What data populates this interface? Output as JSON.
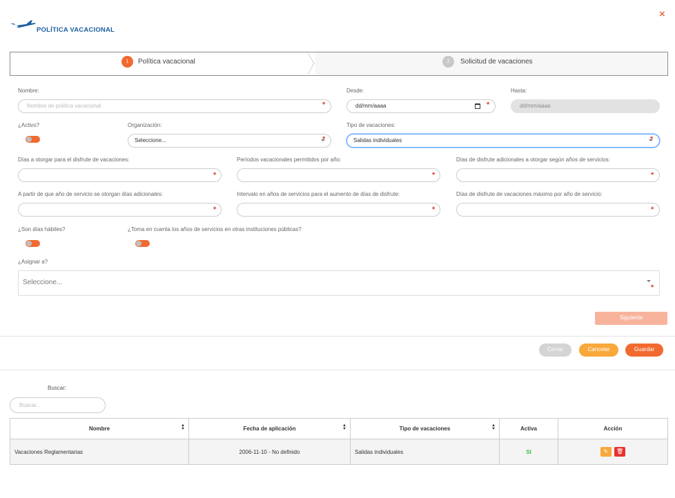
{
  "header": {
    "title": "POLÍTICA VACACIONAL",
    "close_symbol": "×"
  },
  "wizard": {
    "steps": [
      {
        "number": "1",
        "label": "Política vacacional",
        "active": true
      },
      {
        "number": "2",
        "label": "Solicitud de vacaciones",
        "active": false
      }
    ]
  },
  "form": {
    "nombre": {
      "label": "Nombre:",
      "placeholder": "Nombre de política vacacional"
    },
    "desde": {
      "label": "Desde:",
      "value": "dd/mm/aaaa"
    },
    "hasta": {
      "label": "Hasta:",
      "value": "dd/mm/aaaa"
    },
    "activo": {
      "label": "¿Activo?"
    },
    "organizacion": {
      "label": "Organización:",
      "value": "Seleccione..."
    },
    "tipo_vacaciones": {
      "label": "Tipo de vacaciones:",
      "value": "Salidas individuales"
    },
    "dias_otorgar": {
      "label": "Días a otorgar para el disfrute de vacaciones:"
    },
    "periodos": {
      "label": "Períodos vacacionales permitidos por año:"
    },
    "dias_adicionales": {
      "label": "Días de disfrute adicionales a otorgar según años de servicios:"
    },
    "a_partir": {
      "label": "A partir de que año de servicio se otorgan días adicionales:"
    },
    "intervalo": {
      "label": "Intervalo en años de servicios para el aumento de días de disfrute:"
    },
    "dias_maximo": {
      "label": "Días de disfrute de vacaciones máximo por año de servicio:"
    },
    "habiles": {
      "label": "¿Son días hábiles?"
    },
    "toma_cuenta": {
      "label": "¿Toma en cuenta los años de servicios en otras instituciones públicas?"
    },
    "asignar": {
      "label": "¿Asignar a?",
      "value": "Seleccione..."
    },
    "required_mark": "*"
  },
  "buttons": {
    "next": "Siguiente",
    "close": "Cerrar",
    "cancel": "Cancelar",
    "save": "Guardar"
  },
  "search": {
    "label": "Buscar:",
    "placeholder": "Buscar..."
  },
  "table": {
    "columns": [
      "Nombre",
      "Fecha de aplicación",
      "Tipo de vacaciones",
      "Activa",
      "Acción"
    ],
    "rows": [
      {
        "nombre": "Vacaciones Reglamentarias",
        "fecha": "2006-11-10 - No definido",
        "tipo": "Salidas individuales",
        "activa": "SI"
      }
    ]
  },
  "colors": {
    "accent": "#f26a30",
    "title_blue": "#1f5fa0",
    "cancel": "#f9a83b",
    "delete": "#e8322f",
    "active_green": "#3fbf3f"
  },
  "icons": [
    "airplane-icon",
    "close-icon",
    "calendar-icon",
    "chevron-down-icon",
    "sort-icon",
    "edit-icon",
    "trash-icon"
  ]
}
